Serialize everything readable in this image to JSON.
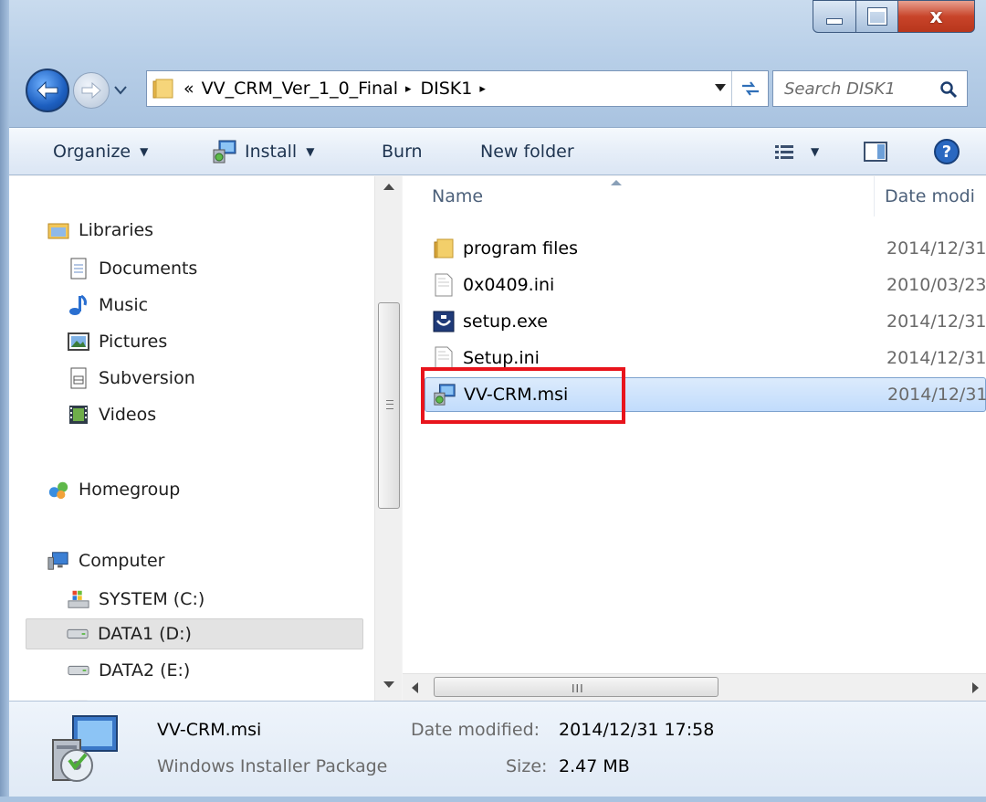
{
  "window": {
    "controls": {
      "close_glyph": "x"
    }
  },
  "address": {
    "overflow_glyph": "«",
    "crumbs": [
      "VV_CRM_Ver_1_0_Final",
      "DISK1"
    ],
    "separator_glyph": "▸"
  },
  "search": {
    "placeholder": "Search DISK1"
  },
  "toolbar": {
    "organize": "Organize",
    "install": "Install",
    "burn": "Burn",
    "new_folder": "New folder",
    "dropdown_glyph": "▼"
  },
  "nav": {
    "libraries": "Libraries",
    "documents": "Documents",
    "music": "Music",
    "pictures": "Pictures",
    "subversion": "Subversion",
    "videos": "Videos",
    "homegroup": "Homegroup",
    "computer": "Computer",
    "system_c": "SYSTEM (C:)",
    "data1_d": "DATA1 (D:)",
    "data2_e": "DATA2 (E:)"
  },
  "columns": {
    "name": "Name",
    "date": "Date modi"
  },
  "files": [
    {
      "name": "program files",
      "date": "2014/12/31",
      "icon": "folder-icon"
    },
    {
      "name": "0x0409.ini",
      "date": "2010/03/23",
      "icon": "ini-file-icon"
    },
    {
      "name": "setup.exe",
      "date": "2014/12/31",
      "icon": "setup-exe-icon"
    },
    {
      "name": "Setup.ini",
      "date": "2014/12/31",
      "icon": "ini-file-icon"
    },
    {
      "name": "VV-CRM.msi",
      "date": "2014/12/31",
      "icon": "msi-installer-icon"
    }
  ],
  "hscroll_grip": "III",
  "details": {
    "name": "VV-CRM.msi",
    "type": "Windows Installer Package",
    "modified_label": "Date modified:",
    "modified_value": "2014/12/31 17:58",
    "size_label": "Size:",
    "size_value": "2.47 MB"
  },
  "colors": {
    "accent": "#e8141c",
    "selection": "#c1dcfc"
  }
}
